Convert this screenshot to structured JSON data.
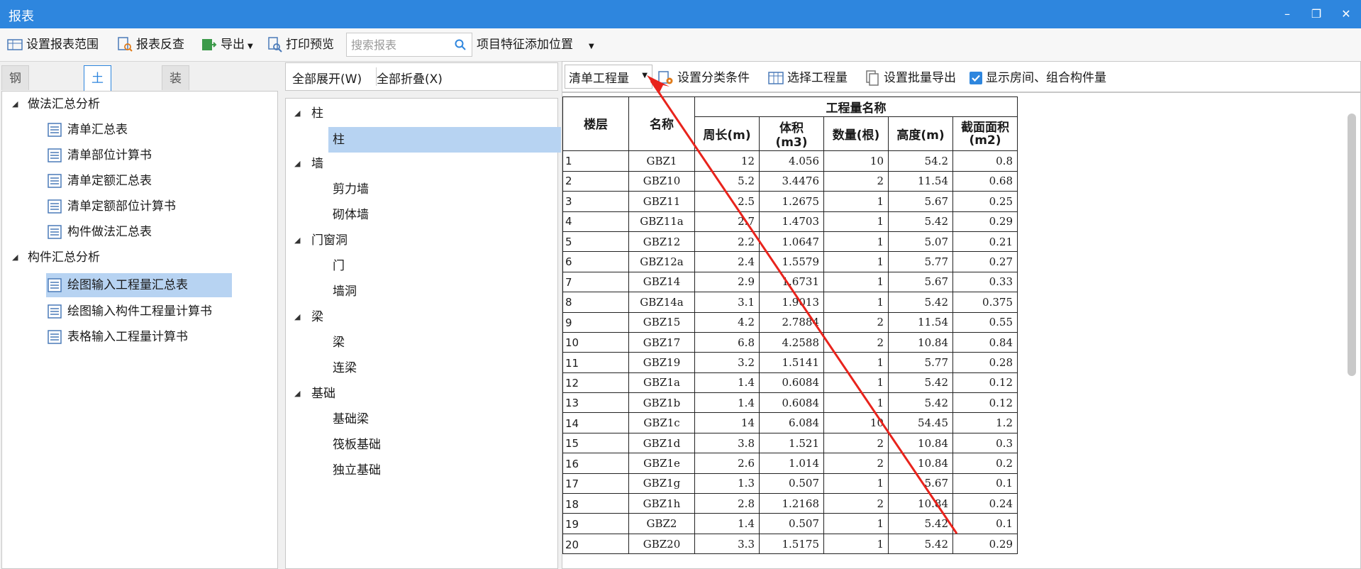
{
  "window": {
    "title": "报表",
    "min": "–",
    "restore": "❐",
    "close": "✕"
  },
  "toolbar": {
    "set_range": "设置报表范围",
    "reverse_check": "报表反查",
    "export": "导出",
    "print_preview": "打印预览",
    "search_placeholder": "搜索报表",
    "feature_position": "项目特征添加位置"
  },
  "tabs": [
    "钢筋报表量",
    "土建报表量",
    "装配式报表量"
  ],
  "report_tree": {
    "group1": "做法汇总分析",
    "group1_items": [
      "清单汇总表",
      "清单部位计算书",
      "清单定额汇总表",
      "清单定额部位计算书",
      "构件做法汇总表"
    ],
    "group2": "构件汇总分析",
    "group2_items": [
      "绘图输入工程量汇总表",
      "绘图输入构件工程量计算书",
      "表格输入工程量计算书"
    ]
  },
  "expand_bar": {
    "expand_all": "全部展开(W)",
    "collapse_all": "全部折叠(X)"
  },
  "component_tree": [
    {
      "label": "柱",
      "children": [
        "柱"
      ]
    },
    {
      "label": "墙",
      "children": [
        "剪力墙",
        "砌体墙"
      ]
    },
    {
      "label": "门窗洞",
      "children": [
        "门",
        "墙洞"
      ]
    },
    {
      "label": "梁",
      "children": [
        "梁",
        "连梁"
      ]
    },
    {
      "label": "基础",
      "children": [
        "基础梁",
        "筏板基础",
        "独立基础"
      ]
    }
  ],
  "right_toolbar": {
    "quantity_select": "清单工程量",
    "set_category": "设置分类条件",
    "select_quantity": "选择工程量",
    "batch_export": "设置批量导出",
    "show_rooms": "显示房间、组合构件量"
  },
  "table": {
    "h_floor": "楼层",
    "h_name": "名称",
    "h_group": "工程量名称",
    "cols": [
      "周长(m)",
      "体积(m3)",
      "数量(根)",
      "高度(m)",
      "截面面积(m2)"
    ],
    "rows": [
      [
        "1",
        "GBZ1",
        "12",
        "4.056",
        "10",
        "54.2",
        "0.8"
      ],
      [
        "2",
        "GBZ10",
        "5.2",
        "3.4476",
        "2",
        "11.54",
        "0.68"
      ],
      [
        "3",
        "GBZ11",
        "2.5",
        "1.2675",
        "1",
        "5.67",
        "0.25"
      ],
      [
        "4",
        "GBZ11a",
        "2.7",
        "1.4703",
        "1",
        "5.42",
        "0.29"
      ],
      [
        "5",
        "GBZ12",
        "2.2",
        "1.0647",
        "1",
        "5.07",
        "0.21"
      ],
      [
        "6",
        "GBZ12a",
        "2.4",
        "1.5579",
        "1",
        "5.77",
        "0.27"
      ],
      [
        "7",
        "GBZ14",
        "2.9",
        "1.6731",
        "1",
        "5.67",
        "0.33"
      ],
      [
        "8",
        "GBZ14a",
        "3.1",
        "1.9013",
        "1",
        "5.42",
        "0.375"
      ],
      [
        "9",
        "GBZ15",
        "4.2",
        "2.7884",
        "2",
        "11.54",
        "0.55"
      ],
      [
        "10",
        "GBZ17",
        "6.8",
        "4.2588",
        "2",
        "10.84",
        "0.84"
      ],
      [
        "11",
        "GBZ19",
        "3.2",
        "1.5141",
        "1",
        "5.77",
        "0.28"
      ],
      [
        "12",
        "GBZ1a",
        "1.4",
        "0.6084",
        "1",
        "5.42",
        "0.12"
      ],
      [
        "13",
        "GBZ1b",
        "1.4",
        "0.6084",
        "1",
        "5.42",
        "0.12"
      ],
      [
        "14",
        "GBZ1c",
        "14",
        "6.084",
        "10",
        "54.45",
        "1.2"
      ],
      [
        "15",
        "GBZ1d",
        "3.8",
        "1.521",
        "2",
        "10.84",
        "0.3"
      ],
      [
        "16",
        "GBZ1e",
        "2.6",
        "1.014",
        "2",
        "10.84",
        "0.2"
      ],
      [
        "17",
        "GBZ1g",
        "1.3",
        "0.507",
        "1",
        "5.67",
        "0.1"
      ],
      [
        "18",
        "GBZ1h",
        "2.8",
        "1.2168",
        "2",
        "10.84",
        "0.24"
      ],
      [
        "19",
        "GBZ2",
        "1.4",
        "0.507",
        "1",
        "5.42",
        "0.1"
      ],
      [
        "20",
        "GBZ20",
        "3.3",
        "1.5175",
        "1",
        "5.42",
        "0.29"
      ]
    ]
  },
  "colors": {
    "accent": "#2e86de",
    "selection": "#b7d3f2",
    "annotation_arrow": "#e8231c"
  }
}
